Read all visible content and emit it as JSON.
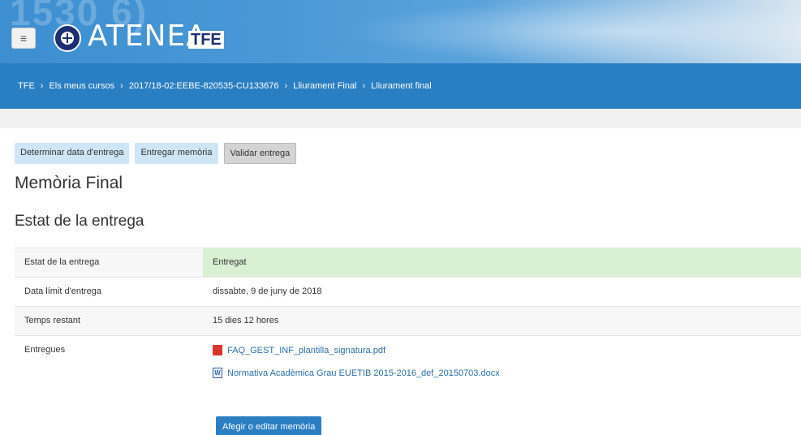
{
  "header": {
    "ghost_text": "1530 6)",
    "logo_text": "ATENEA",
    "logo_sub": "TFE",
    "menu_icon": "hamburger-icon",
    "colors": {
      "header": "#4a98d6",
      "crumb_bar": "#2a7ec2",
      "logo_dark": "#1b2f72"
    }
  },
  "breadcrumb": [
    "TFE",
    "Els meus cursos",
    "2017/18-02:EEBE-820535-CU133676",
    "Lliurament Final",
    "Lliurament final"
  ],
  "actions": [
    {
      "label": "Determinar data d'entrega"
    },
    {
      "label": "Entregar memòria"
    },
    {
      "label": "Validar entrega"
    }
  ],
  "page_title": "Memòria Final",
  "section_title": "Estat de la entrega",
  "status_table": {
    "rows": [
      {
        "label": "Estat de la entrega",
        "value": "Entregat"
      },
      {
        "label": "Data límit d'entrega",
        "value": "dissabte, 9 de juny de 2018"
      },
      {
        "label": "Temps restant",
        "value": "15 dies 12 hores"
      },
      {
        "label": "Entregues"
      }
    ],
    "files": [
      {
        "name": "FAQ_GEST_INF_plantilla_signatura.pdf",
        "icon": "pdf-file-icon",
        "color": "#d9362b"
      },
      {
        "name": "Normativa Acadèmica Grau EUETIB 2015-2016_def_20150703.docx",
        "icon": "word-file-icon",
        "glyph": "W",
        "color": "#2b5aa7"
      }
    ],
    "status_color": "#d9f0d3"
  },
  "edit_button": "Afegir o editar memòria"
}
